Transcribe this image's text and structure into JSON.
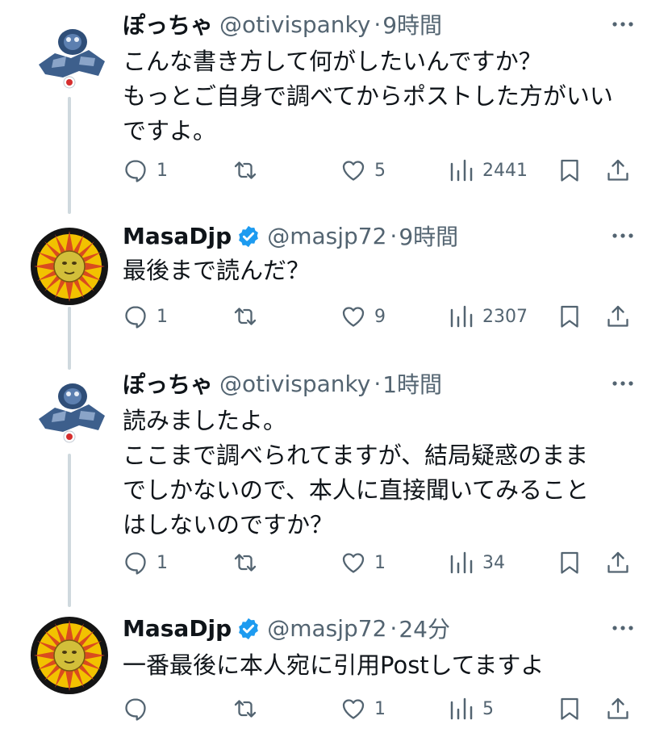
{
  "tweets": [
    {
      "user": "pocchya",
      "name": "ぽっちゃ",
      "handle": "@otivispanky",
      "time": "9時間",
      "verified": false,
      "lines": [
        "こんな書き方して何がしたいんですか？",
        "もっとご自身で調べてからポストした方がいい",
        "ですよ。"
      ],
      "replies": "1",
      "retweets": "",
      "likes": "5",
      "views": "2441"
    },
    {
      "user": "masa",
      "name": "MasaDjp",
      "handle": "@masjp72",
      "time": "9時間",
      "verified": true,
      "lines": [
        "最後まで読んだ？"
      ],
      "replies": "1",
      "retweets": "",
      "likes": "9",
      "views": "2307"
    },
    {
      "user": "pocchya",
      "name": "ぽっちゃ",
      "handle": "@otivispanky",
      "time": "1時間",
      "verified": false,
      "lines": [
        "読みましたよ。",
        "ここまで調べられてますが、結局疑惑のまま",
        "でしかないので、本人に直接聞いてみること",
        "はしないのですか？"
      ],
      "replies": "1",
      "retweets": "",
      "likes": "1",
      "views": "34"
    },
    {
      "user": "masa",
      "name": "MasaDjp",
      "handle": "@masjp72",
      "time": "24分",
      "verified": true,
      "lines": [
        "一番最後に本人宛に引用Postしてますよ"
      ],
      "replies": "",
      "retweets": "",
      "likes": "1",
      "views": "5"
    }
  ],
  "separator": "·",
  "icons": {
    "reply": "speech-bubble-icon",
    "retweet": "retweet-arrows-icon",
    "like": "heart-icon",
    "views": "bar-chart-icon",
    "bookmark": "bookmark-icon",
    "share": "share-upload-icon",
    "more": "ellipsis-icon",
    "verified": "verified-badge-icon"
  },
  "colors": {
    "text": "#0f1419",
    "secondary": "#536471",
    "verified": "#1d9bf0",
    "thread_line": "#cfd9de"
  }
}
